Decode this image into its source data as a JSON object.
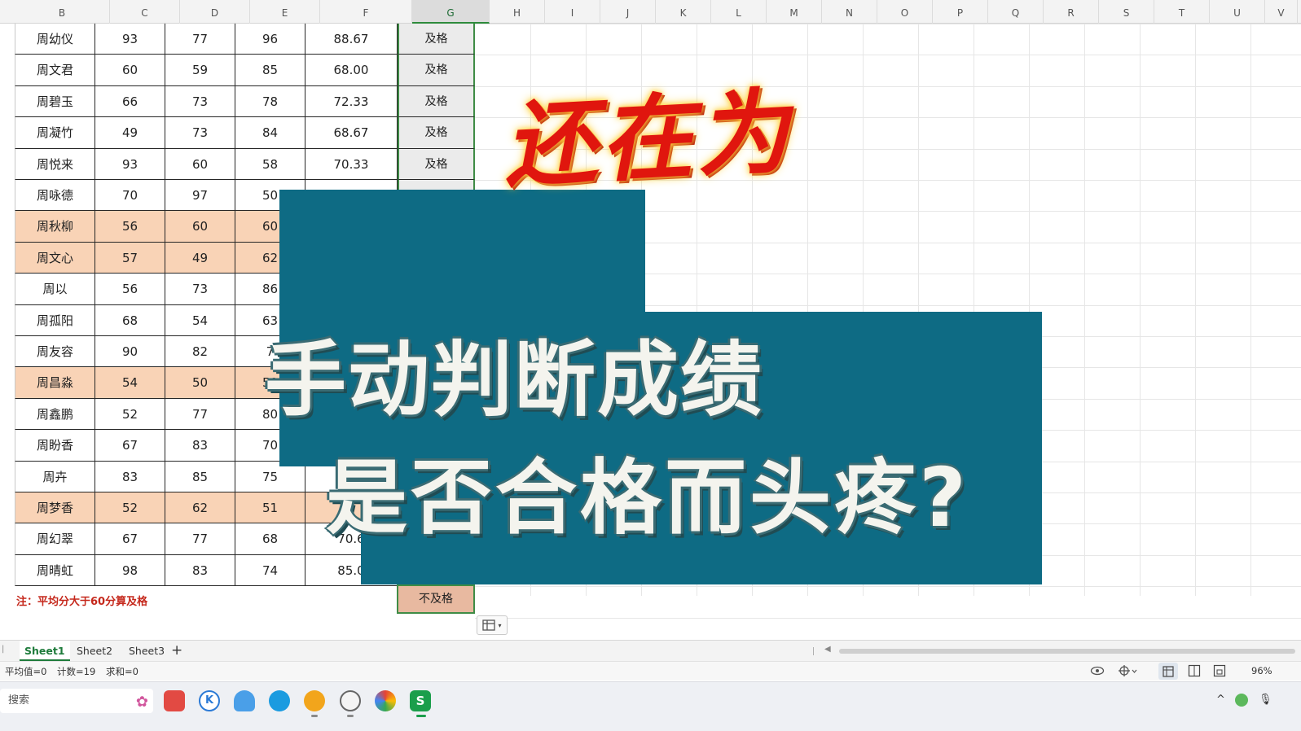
{
  "columns": [
    "B",
    "C",
    "D",
    "E",
    "F",
    "G",
    "H",
    "I",
    "J",
    "K",
    "L",
    "M",
    "N",
    "O",
    "P",
    "Q",
    "R",
    "S",
    "T",
    "U",
    "V"
  ],
  "selected_column": "G",
  "rows": [
    {
      "name": "周幼仪",
      "c": "93",
      "d": "77",
      "e": "96",
      "f": "88.67",
      "g": "及格",
      "highlight": false
    },
    {
      "name": "周文君",
      "c": "60",
      "d": "59",
      "e": "85",
      "f": "68.00",
      "g": "及格",
      "highlight": false
    },
    {
      "name": "周碧玉",
      "c": "66",
      "d": "73",
      "e": "78",
      "f": "72.33",
      "g": "及格",
      "highlight": false
    },
    {
      "name": "周凝竹",
      "c": "49",
      "d": "73",
      "e": "84",
      "f": "68.67",
      "g": "及格",
      "highlight": false
    },
    {
      "name": "周悦来",
      "c": "93",
      "d": "60",
      "e": "58",
      "f": "70.33",
      "g": "及格",
      "highlight": false
    },
    {
      "name": "周咏德",
      "c": "70",
      "d": "97",
      "e": "50",
      "f": "",
      "g": "",
      "highlight": false
    },
    {
      "name": "周秋柳",
      "c": "56",
      "d": "60",
      "e": "60",
      "f": "",
      "g": "",
      "highlight": true
    },
    {
      "name": "周文心",
      "c": "57",
      "d": "49",
      "e": "62",
      "f": "",
      "g": "",
      "highlight": true
    },
    {
      "name": "周以",
      "c": "56",
      "d": "73",
      "e": "86",
      "f": "",
      "g": "",
      "highlight": false
    },
    {
      "name": "周孤阳",
      "c": "68",
      "d": "54",
      "e": "63",
      "f": "",
      "g": "",
      "highlight": false
    },
    {
      "name": "周友容",
      "c": "90",
      "d": "82",
      "e": "7",
      "f": "",
      "g": "",
      "highlight": false
    },
    {
      "name": "周昌淼",
      "c": "54",
      "d": "50",
      "e": "50",
      "f": "",
      "g": "",
      "highlight": true
    },
    {
      "name": "周鑫鹏",
      "c": "52",
      "d": "77",
      "e": "80",
      "f": "",
      "g": "",
      "highlight": false
    },
    {
      "name": "周盼香",
      "c": "67",
      "d": "83",
      "e": "70",
      "f": "",
      "g": "",
      "highlight": false
    },
    {
      "name": "周卉",
      "c": "83",
      "d": "85",
      "e": "75",
      "f": "",
      "g": "",
      "highlight": false
    },
    {
      "name": "周梦香",
      "c": "52",
      "d": "62",
      "e": "51",
      "f": "",
      "g": "",
      "highlight": true
    },
    {
      "name": "周幻翠",
      "c": "67",
      "d": "77",
      "e": "68",
      "f": "70.6",
      "g": "",
      "highlight": false
    },
    {
      "name": "周晴虹",
      "c": "98",
      "d": "83",
      "e": "74",
      "f": "85.0",
      "g": "",
      "highlight": false
    }
  ],
  "last_cell": "不及格",
  "note": "注：平均分大于60分算及格",
  "overlay": {
    "red_title": "还在为",
    "line1": "手动判断成绩",
    "line2": "是否合格而头疼?"
  },
  "sheets": [
    "Sheet1",
    "Sheet2",
    "Sheet3"
  ],
  "add_sheet": "+",
  "status": {
    "average": "平均值=0",
    "count": "计数=19",
    "sum": "求和=0",
    "zoom": "96%"
  },
  "taskbar": {
    "search_placeholder": "搜索"
  },
  "colors": {
    "highlight_row": "#f9d3b6",
    "banner": "#0e6b84",
    "note_text": "#c5281c",
    "selection_border": "#3f8c46"
  }
}
